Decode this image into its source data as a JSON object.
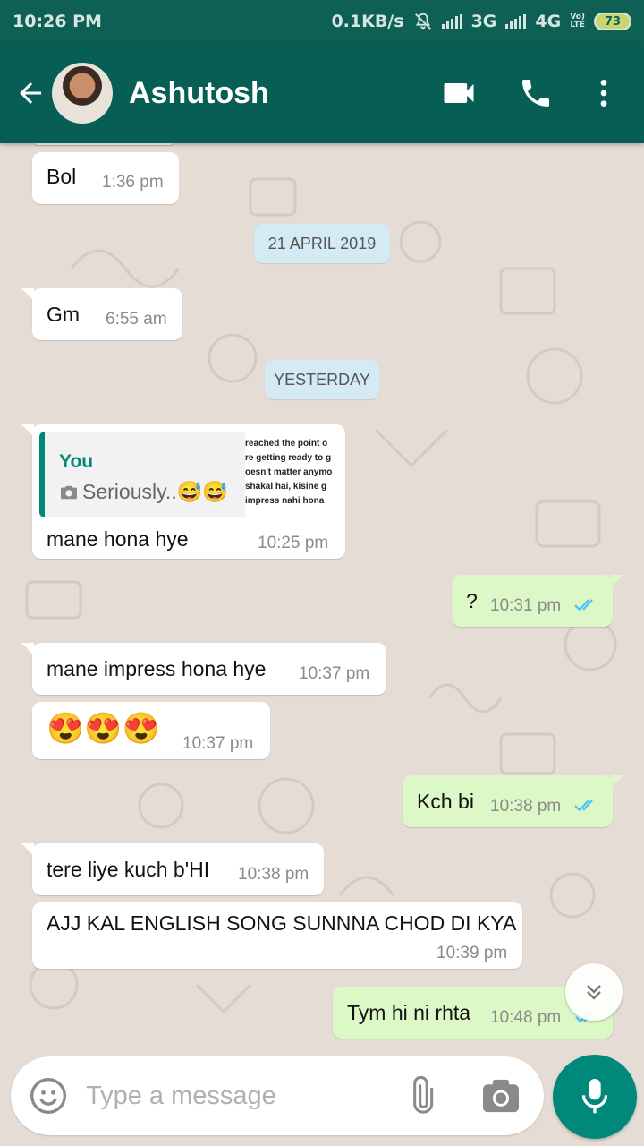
{
  "status_bar": {
    "time": "10:26 PM",
    "speed": "0.1KB/s",
    "net1": "3G",
    "net2": "4G",
    "volte_top": "Vo)",
    "volte_bottom": "LTE",
    "battery": "73"
  },
  "header": {
    "contact_name": "Ashutosh"
  },
  "chat": {
    "dates": [
      "21 APRIL 2019",
      "YESTERDAY"
    ],
    "messages": [
      {
        "dir": "in",
        "text": "Bol",
        "time": "1:36 pm"
      },
      {
        "dir": "in",
        "text": "Gm",
        "time": "6:55 am"
      },
      {
        "dir": "in",
        "text": "mane hona hye",
        "time": "10:25 pm",
        "reply": {
          "author": "You",
          "text": "Seriously..😅😅",
          "thumb_lines": [
            "reached the point o",
            "re getting ready to g",
            "oesn't matter anymo",
            "shakal hai, kisine g",
            "impress nahi hona"
          ]
        }
      },
      {
        "dir": "out",
        "text": "?",
        "time": "10:31 pm",
        "status": "read"
      },
      {
        "dir": "in",
        "text": "mane impress hona hye",
        "time": "10:37 pm"
      },
      {
        "dir": "in",
        "text": "😍😍😍",
        "time": "10:37 pm"
      },
      {
        "dir": "out",
        "text": "Kch bi",
        "time": "10:38 pm",
        "status": "read"
      },
      {
        "dir": "in",
        "text": "tere liye kuch b'HI",
        "time": "10:38 pm"
      },
      {
        "dir": "in",
        "text": "AJJ KAL ENGLISH SONG SUNNNA CHOD DI KYA",
        "time": "10:39 pm"
      },
      {
        "dir": "out",
        "text": "Tym hi ni rhta",
        "time": "10:48 pm",
        "status": "read"
      }
    ]
  },
  "composer": {
    "placeholder": "Type a message"
  },
  "colors": {
    "header": "#075e54",
    "status_bar": "#0e5f54",
    "incoming": "#ffffff",
    "outgoing": "#dcf8c6",
    "accent": "#00897b",
    "read_ticks": "#4fc3f7",
    "chat_bg": "#e5ddd5"
  },
  "icons": [
    "back-arrow-icon",
    "video-call-icon",
    "voice-call-icon",
    "more-options-icon",
    "camera-icon",
    "emoji-icon",
    "attach-icon",
    "mic-icon",
    "scroll-down-icon",
    "read-ticks-icon"
  ]
}
